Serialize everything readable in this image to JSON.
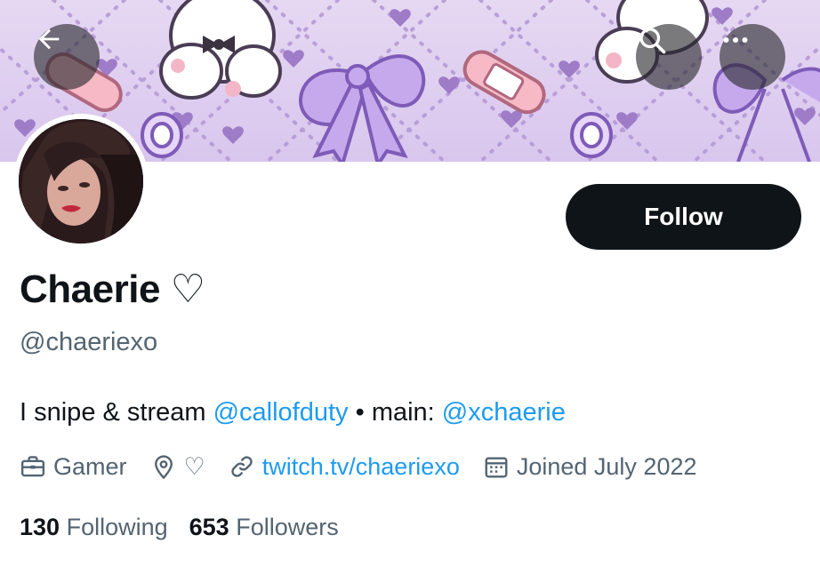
{
  "profile": {
    "name": "Chaerie ♡",
    "handle": "@chaeriexo",
    "bio": {
      "text1": "I snipe & stream ",
      "mention1": "@callofduty",
      "text2": " • main: ",
      "mention2": "@xchaerie"
    },
    "meta": {
      "category": "Gamer",
      "location": "♡",
      "website": "twitch.tv/chaeriexo",
      "joined": "Joined July 2022"
    },
    "stats": {
      "following_count": "130",
      "following_label": "Following",
      "followers_count": "653",
      "followers_label": "Followers"
    }
  },
  "actions": {
    "follow_label": "Follow"
  },
  "icons": {
    "back": "arrow-left-icon",
    "search": "search-icon",
    "more": "more-horizontal-icon",
    "category": "briefcase-icon",
    "location": "location-pin-icon",
    "website": "link-icon",
    "joined": "calendar-icon"
  },
  "colors": {
    "link": "#1d9bf0",
    "follow_bg": "#0f1419",
    "muted_text": "#536471",
    "banner_bg": "#d9c6ee"
  }
}
